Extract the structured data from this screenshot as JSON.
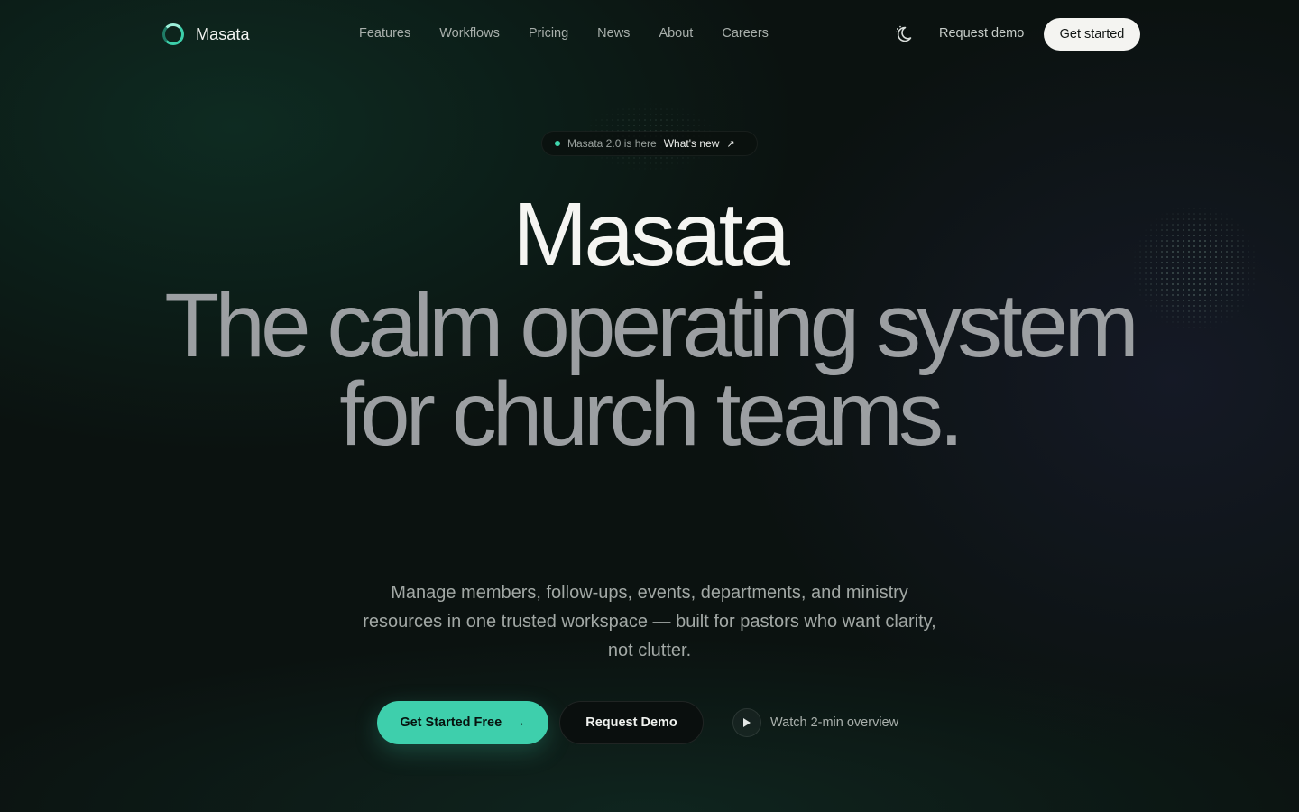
{
  "nav": {
    "brand": "Masata",
    "links": [
      "Features",
      "Workflows",
      "Pricing",
      "News",
      "About",
      "Careers"
    ],
    "request_demo": "Request demo",
    "get_started": "Get started"
  },
  "badge": {
    "text": "Masata 2.0 is here",
    "link": "What's new",
    "arrow": "↗"
  },
  "hero": {
    "title": "Masata",
    "headline": "The calm operating system for church teams.",
    "subtitle": "Manage members, follow-ups, events, departments, and ministry resources in one trusted workspace — built for pastors who want clarity, not clutter."
  },
  "cta": {
    "primary": "Get Started Free",
    "primary_arrow": "→",
    "secondary": "Request Demo",
    "watch": "Watch 2-min overview"
  },
  "colors": {
    "accent": "#3ecfac",
    "background": "#0b1210",
    "headline": "#9c9fa2"
  },
  "icons": {
    "logo": "ring-logo-icon",
    "theme": "moon-icon",
    "play": "play-icon"
  }
}
